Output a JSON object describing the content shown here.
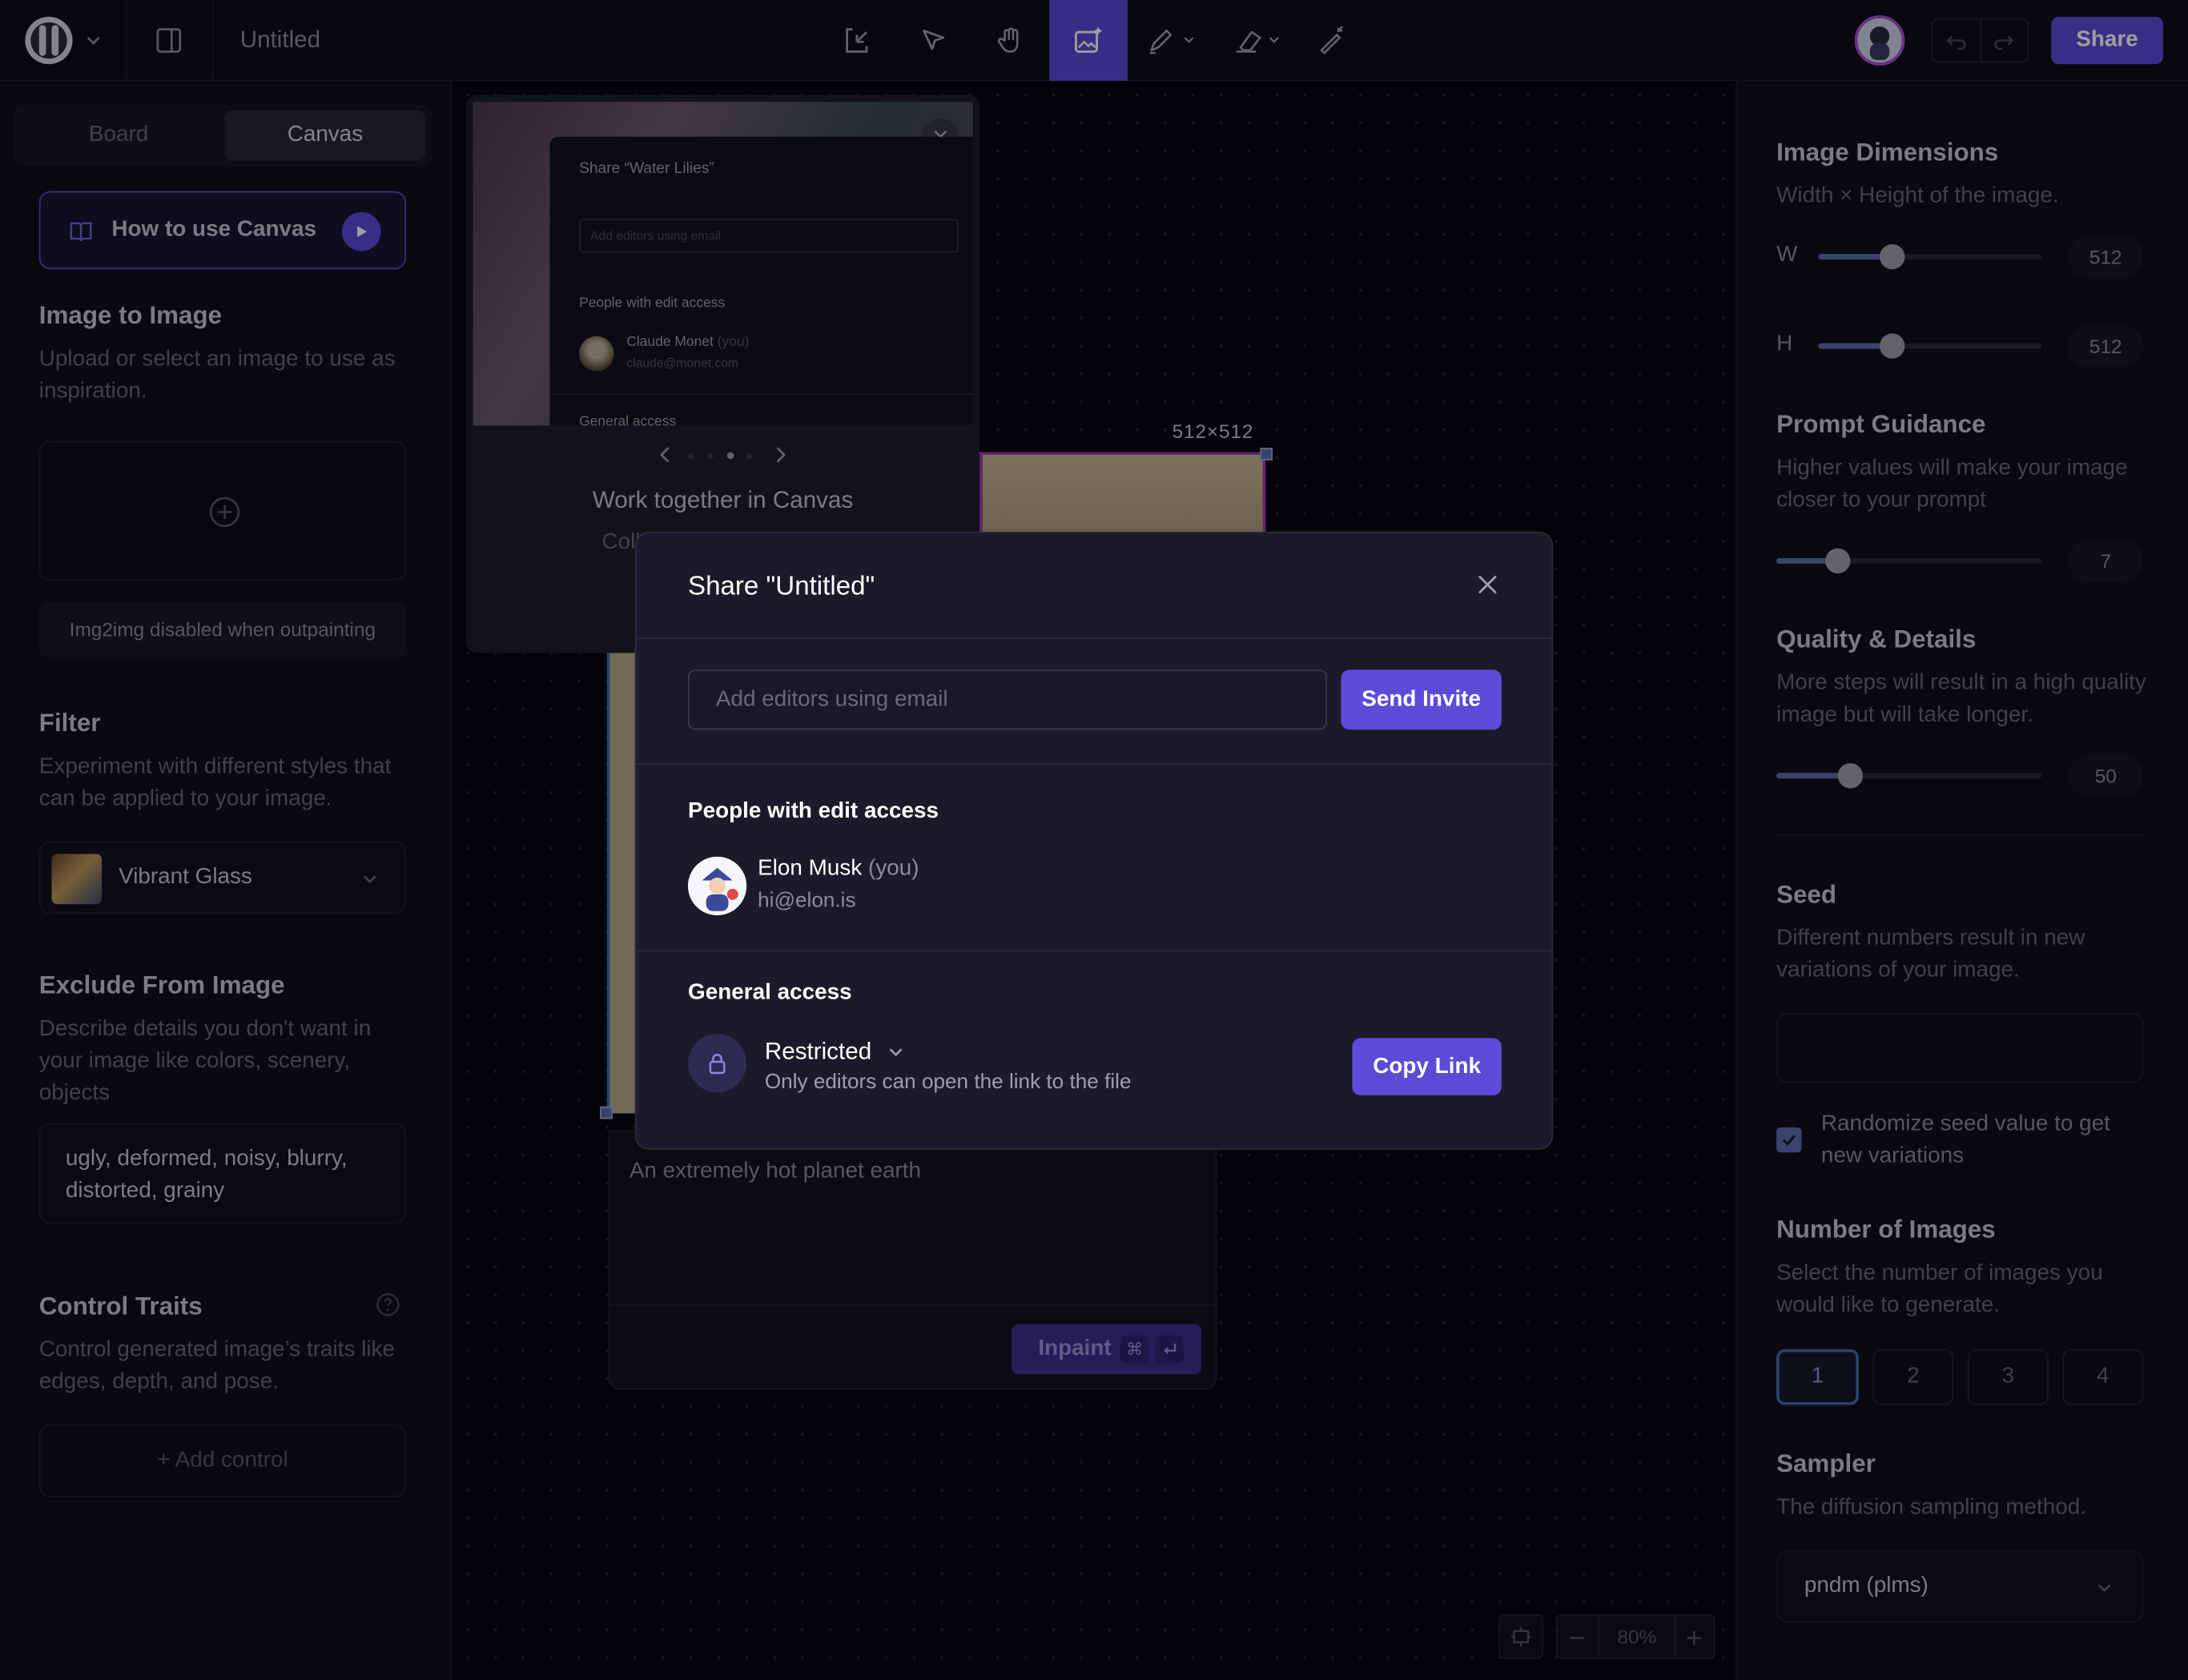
{
  "topbar": {
    "doc_title": "Untitled",
    "share_label": "Share",
    "tools": [
      "import-icon",
      "select-icon",
      "hand-icon",
      "generate-image-icon",
      "pencil-icon",
      "eraser-icon",
      "magic-wand-icon"
    ]
  },
  "left": {
    "tabs": [
      "Board",
      "Canvas"
    ],
    "active_tab": "Canvas",
    "how_to": "How to use Canvas",
    "img2img": {
      "title": "Image to Image",
      "desc": "Upload or select an image to use as inspiration.",
      "note": "Img2img disabled when outpainting"
    },
    "filter": {
      "title": "Filter",
      "desc": "Experiment with different styles that can be applied to your image.",
      "selected": "Vibrant Glass"
    },
    "exclude": {
      "title": "Exclude From Image",
      "desc": "Describe details you don't want in your image like colors, scenery, objects",
      "value": "ugly, deformed, noisy, blurry, distorted, grainy"
    },
    "control": {
      "title": "Control Traits",
      "desc": "Control generated image’s traits like edges, depth, and pose.",
      "add": "+ Add control"
    }
  },
  "right": {
    "dimensions": {
      "title": "Image Dimensions",
      "desc": "Width × Height of the image.",
      "w_label": "W",
      "h_label": "H",
      "width": "512",
      "height": "512",
      "w_fraction": 0.33,
      "h_fraction": 0.33
    },
    "guidance": {
      "title": "Prompt Guidance",
      "desc": "Higher values will make your image closer to your prompt",
      "value": "7",
      "fraction": 0.23
    },
    "quality": {
      "title": "Quality & Details",
      "desc": "More steps will result in a high quality image but will take longer.",
      "value": "50",
      "fraction": 0.28
    },
    "seed": {
      "title": "Seed",
      "desc": "Different numbers result in new variations of your image.",
      "randomize": "Randomize seed value to get new variations",
      "randomize_checked": true
    },
    "num_images": {
      "title": "Number of Images",
      "desc": "Select the number of images you would like to generate.",
      "options": [
        "1",
        "2",
        "3",
        "4"
      ],
      "selected": "1"
    },
    "sampler": {
      "title": "Sampler",
      "desc": "The diffusion sampling method.",
      "value": "pndm (plms)"
    }
  },
  "canvas": {
    "size_label": "512×512",
    "prompt": "An extremely hot planet earth",
    "inpaint_label": "Inpaint",
    "zoom": "80%",
    "tutorial": {
      "title": "Work together in Canvas",
      "body": "Collaborate with another",
      "preview": {
        "title": "Share “Water Lilies”",
        "placeholder": "Add editors using email",
        "people_heading": "People with edit access",
        "person_name": "Claude Monet",
        "person_you": "(you)",
        "person_email": "claude@monet.com",
        "general": "General access"
      }
    }
  },
  "modal": {
    "title": "Share \"Untitled\"",
    "email_placeholder": "Add editors using email",
    "send_label": "Send Invite",
    "people_heading": "People with edit access",
    "person_name": "Elon Musk",
    "person_you": "(you)",
    "person_email": "hi@elon.is",
    "general_heading": "General access",
    "access_level": "Restricted",
    "access_desc": "Only editors can open the link to the file",
    "copy_label": "Copy Link"
  }
}
